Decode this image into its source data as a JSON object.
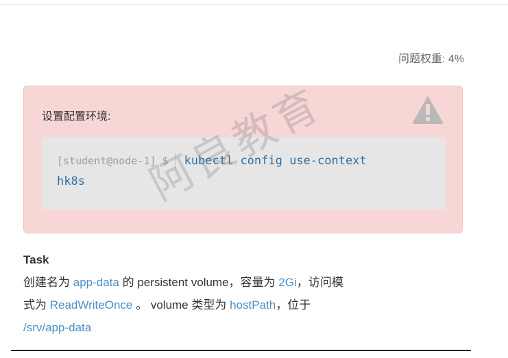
{
  "header": {
    "weight_label": "问题权重: 4%"
  },
  "alert": {
    "title": "设置配置环境:",
    "icon": "warning-triangle-icon",
    "background": "#f7d6d6"
  },
  "code": {
    "prompt": "[student@node-1] $",
    "command_line1": "kubectl config use-context",
    "command_line2": "hk8s"
  },
  "watermark": {
    "text": "阿良教育"
  },
  "task": {
    "heading": "Task",
    "p1": "创建名为",
    "name": "app-data",
    "p2": "的 persistent volume，容量为",
    "capacity": "2Gi",
    "p3": "，访问模",
    "p4": "式为",
    "access_mode": "ReadWriteOnce",
    "p5": "。 volume 类型为",
    "volume_type": "hostPath",
    "p6": "，位于",
    "path": "/srv/app-data"
  },
  "colors": {
    "link": "#4a8fc7",
    "command": "#2f6fa0",
    "prompt": "#9c9c9c"
  }
}
